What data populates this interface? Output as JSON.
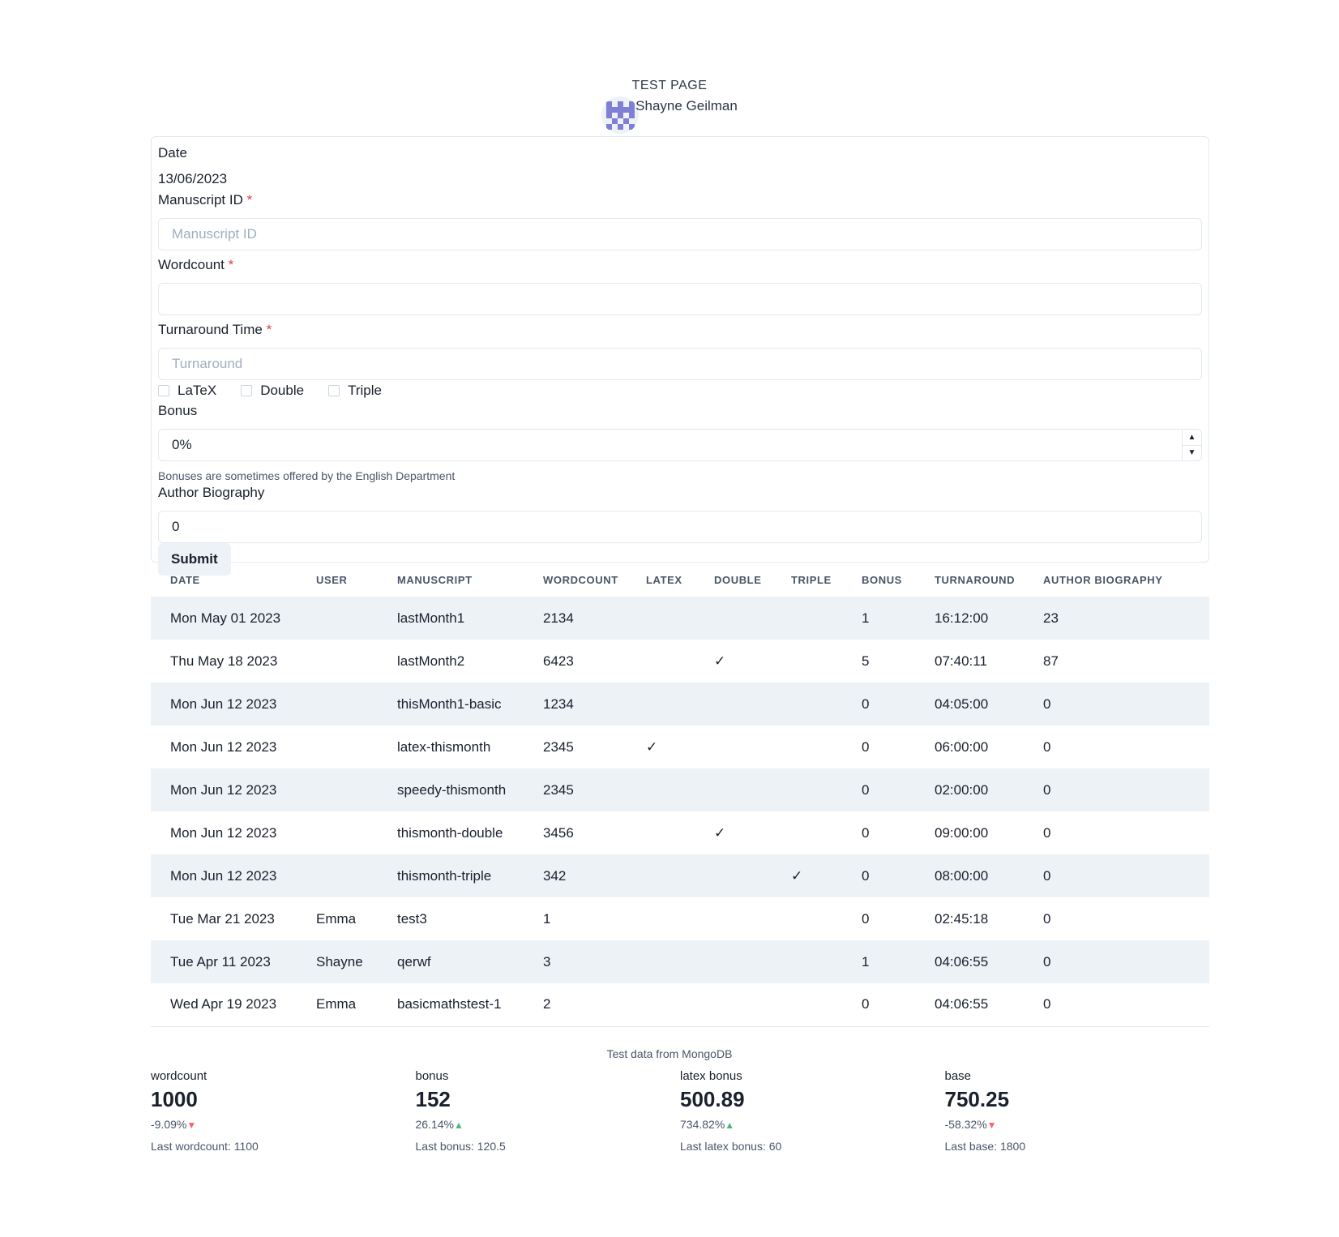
{
  "header": {
    "title": "TEST PAGE",
    "user_name": "Shayne Geilman"
  },
  "form": {
    "date_label": "Date",
    "date_value": "13/06/2023",
    "manuscript_label": "Manuscript ID",
    "manuscript_placeholder": "Manuscript ID",
    "manuscript_value": "",
    "wordcount_label": "Wordcount",
    "wordcount_value": "",
    "turnaround_label": "Turnaround Time",
    "turnaround_placeholder": "Turnaround",
    "turnaround_value": "",
    "required_mark": "*",
    "checkboxes": {
      "latex": "LaTeX",
      "double": "Double",
      "triple": "Triple"
    },
    "bonus_label": "Bonus",
    "bonus_value": "0%",
    "bonus_help": "Bonuses are sometimes offered by the English Department",
    "biography_label": "Author Biography",
    "biography_value": "0",
    "submit_label": "Submit"
  },
  "table": {
    "headers": [
      "DATE",
      "USER",
      "MANUSCRIPT",
      "WORDCOUNT",
      "LATEX",
      "DOUBLE",
      "TRIPLE",
      "BONUS",
      "TURNAROUND",
      "AUTHOR BIOGRAPHY"
    ],
    "rows": [
      [
        "Mon May 01 2023",
        "",
        "lastMonth1",
        "2134",
        "",
        "",
        "",
        "1",
        "16:12:00",
        "23"
      ],
      [
        "Thu May 18 2023",
        "",
        "lastMonth2",
        "6423",
        "",
        "✓",
        "",
        "5",
        "07:40:11",
        "87"
      ],
      [
        "Mon Jun 12 2023",
        "",
        "thisMonth1-basic",
        "1234",
        "",
        "",
        "",
        "0",
        "04:05:00",
        "0"
      ],
      [
        "Mon Jun 12 2023",
        "",
        "latex-thismonth",
        "2345",
        "✓",
        "",
        "",
        "0",
        "06:00:00",
        "0"
      ],
      [
        "Mon Jun 12 2023",
        "",
        "speedy-thismonth",
        "2345",
        "",
        "",
        "",
        "0",
        "02:00:00",
        "0"
      ],
      [
        "Mon Jun 12 2023",
        "",
        "thismonth-double",
        "3456",
        "",
        "✓",
        "",
        "0",
        "09:00:00",
        "0"
      ],
      [
        "Mon Jun 12 2023",
        "",
        "thismonth-triple",
        "342",
        "",
        "",
        "✓",
        "0",
        "08:00:00",
        "0"
      ],
      [
        "Tue Mar 21 2023",
        "Emma",
        "test3",
        "1",
        "",
        "",
        "",
        "0",
        "02:45:18",
        "0"
      ],
      [
        "Tue Apr 11 2023",
        "Shayne",
        "qerwf",
        "3",
        "",
        "",
        "",
        "1",
        "04:06:55",
        "0"
      ],
      [
        "Wed Apr 19 2023",
        "Emma",
        "basicmathstest-1",
        "2",
        "",
        "",
        "",
        "0",
        "04:06:55",
        "0"
      ]
    ]
  },
  "stats": {
    "caption": "Test data from MongoDB",
    "items": [
      {
        "label": "wordcount",
        "number": "1000",
        "change": "-9.09%",
        "direction": "decrease",
        "last": "Last wordcount: 1100"
      },
      {
        "label": "bonus",
        "number": "152",
        "change": "26.14%",
        "direction": "increase",
        "last": "Last bonus: 120.5"
      },
      {
        "label": "latex bonus",
        "number": "500.89",
        "change": "734.82%",
        "direction": "increase",
        "last": "Last latex bonus: 60"
      },
      {
        "label": "base",
        "number": "750.25",
        "change": "-58.32%",
        "direction": "decrease",
        "last": "Last base: 1800"
      }
    ]
  },
  "colors": {
    "increase": "#48bb78",
    "decrease": "#f56565",
    "avatar": "#7f7fd5"
  },
  "icons": {
    "increase": "triangle-up-icon",
    "decrease": "triangle-down-icon",
    "avatar": "identicon-avatar"
  }
}
